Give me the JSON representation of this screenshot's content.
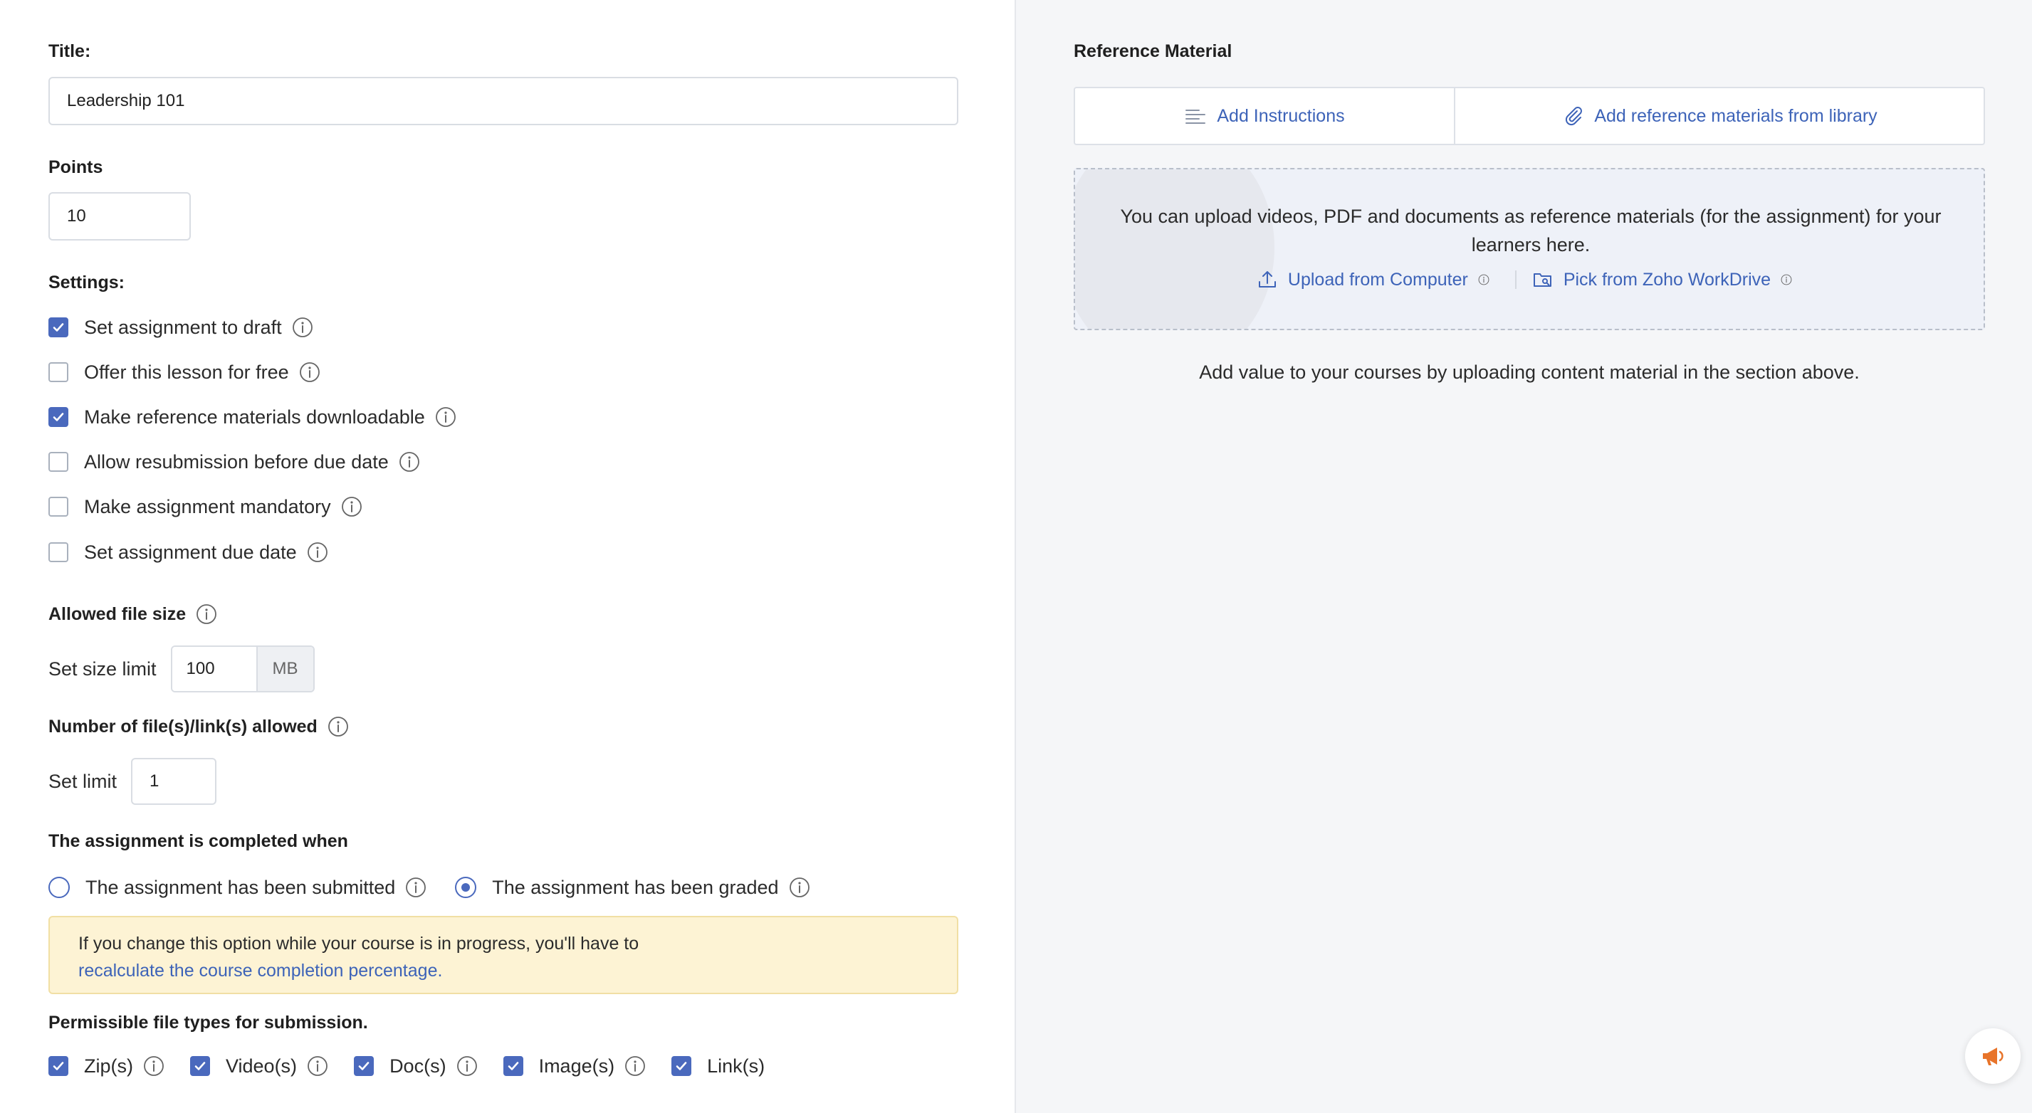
{
  "form": {
    "title_label": "Title:",
    "title_value": "Leadership 101",
    "points_label": "Points",
    "points_value": "10",
    "settings_label": "Settings:",
    "settings": [
      {
        "label": "Set assignment to draft",
        "checked": true
      },
      {
        "label": "Offer this lesson for free",
        "checked": false
      },
      {
        "label": "Make reference materials downloadable",
        "checked": true
      },
      {
        "label": "Allow resubmission before due date",
        "checked": false
      },
      {
        "label": "Make assignment mandatory",
        "checked": false
      },
      {
        "label": "Set assignment due date",
        "checked": false
      }
    ],
    "file_size_label": "Allowed file size",
    "size_limit_label": "Set size limit",
    "size_limit_value": "100",
    "size_unit": "MB",
    "file_count_label": "Number of file(s)/link(s) allowed",
    "set_limit_label": "Set limit",
    "set_limit_value": "1",
    "completion_label": "The assignment is completed when",
    "completion_options": [
      {
        "label": "The assignment has been submitted",
        "selected": false
      },
      {
        "label": "The assignment has been graded",
        "selected": true
      }
    ],
    "note_text": "If you change this option while your course is in progress, you'll have to",
    "note_link": "recalculate the course completion percentage.",
    "file_types_label": "Permissible file types for submission.",
    "file_types": [
      {
        "label": "Zip(s)",
        "checked": true,
        "info": true
      },
      {
        "label": "Video(s)",
        "checked": true,
        "info": true
      },
      {
        "label": "Doc(s)",
        "checked": true,
        "info": true
      },
      {
        "label": "Image(s)",
        "checked": true,
        "info": true
      },
      {
        "label": "Link(s)",
        "checked": true,
        "info": false
      }
    ]
  },
  "reference": {
    "heading": "Reference Material",
    "tab_instructions": "Add Instructions",
    "tab_library": "Add reference materials from library",
    "upload_text": "You can upload videos, PDF and documents as reference materials (for the assignment) for your learners here.",
    "upload_computer": "Upload from Computer",
    "upload_workdrive": "Pick from Zoho WorkDrive",
    "hint": "Add value to your courses by uploading content material in the section above."
  },
  "colors": {
    "accent": "#4a69bd",
    "link": "#3d63b8",
    "note_bg": "#fdf3d4",
    "fab_icon": "#e8742a"
  },
  "icons": {
    "info": "info-icon",
    "check": "check-icon",
    "instructions": "instructions-icon",
    "library": "paperclip-icon",
    "upload": "upload-icon",
    "workdrive": "folder-search-icon",
    "announcement": "megaphone-icon"
  }
}
